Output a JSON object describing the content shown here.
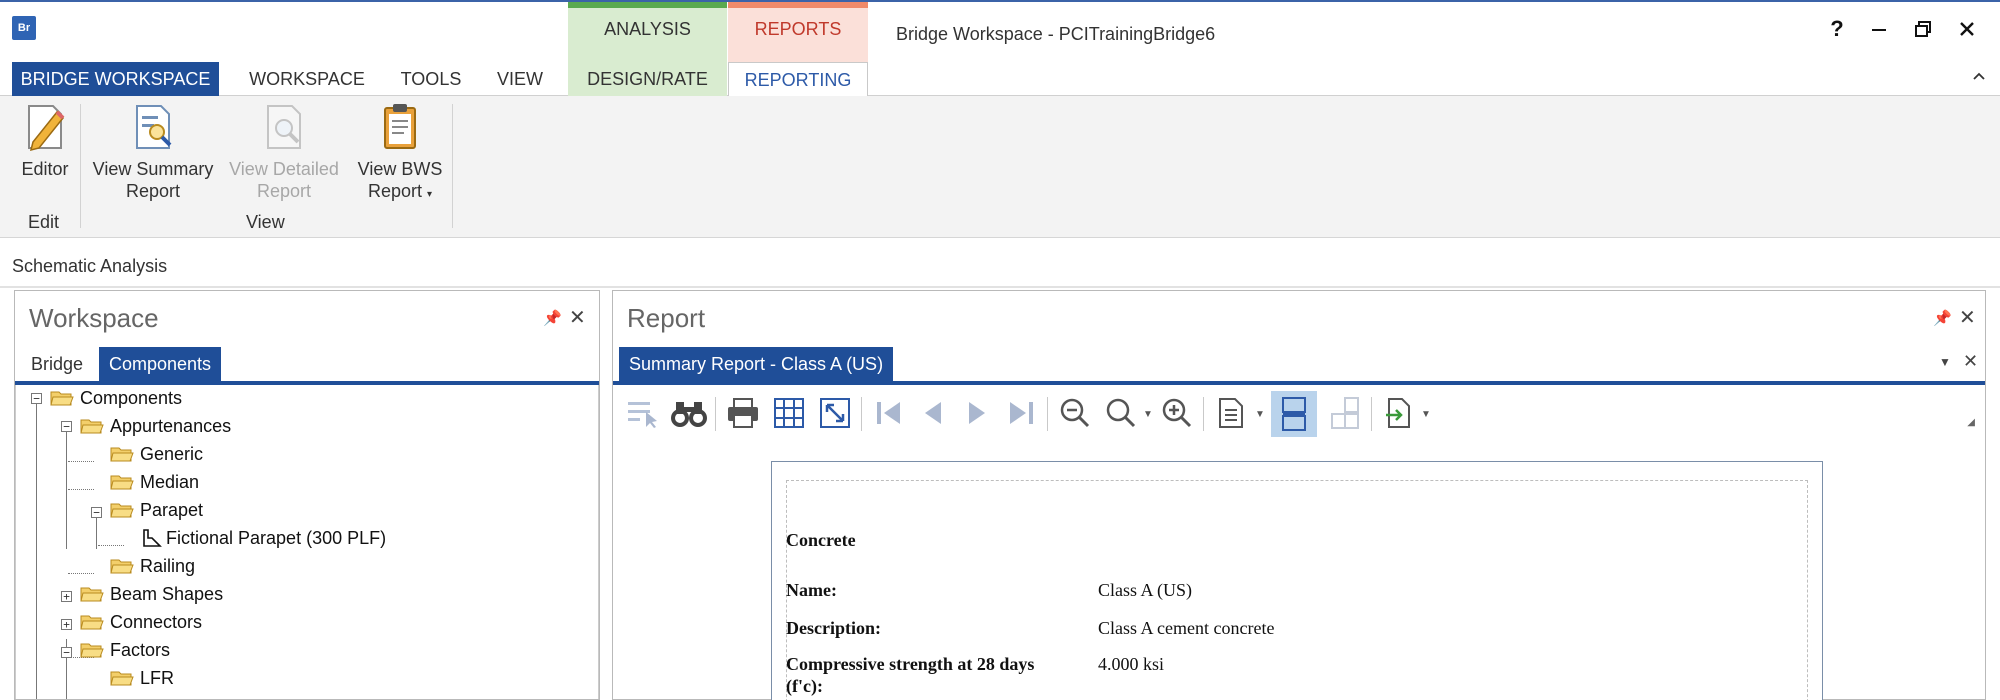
{
  "app": {
    "logo_text": "Br",
    "window_title": "Bridge Workspace - PCITrainingBridge6",
    "window_buttons": {
      "help": "?",
      "minimize": "—",
      "restore": "🗗",
      "close": "✕"
    }
  },
  "context_tabs": {
    "analysis": {
      "label": "ANALYSIS",
      "color": "#d9ecd0",
      "accent": "#5aaa4f"
    },
    "reports": {
      "label": "REPORTS",
      "color": "#fbe0d9",
      "accent": "#f08a6a"
    }
  },
  "tabs": [
    {
      "label": "BRIDGE WORKSPACE"
    },
    {
      "label": "WORKSPACE"
    },
    {
      "label": "TOOLS"
    },
    {
      "label": "VIEW"
    },
    {
      "label": "DESIGN/RATE"
    },
    {
      "label": "REPORTING"
    }
  ],
  "ribbon": {
    "editor": {
      "line1": "Editor",
      "line2": ""
    },
    "view_summary": {
      "line1": "View Summary",
      "line2": "Report"
    },
    "view_detailed": {
      "line1": "View Detailed",
      "line2": "Report"
    },
    "view_bws": {
      "line1": "View BWS",
      "line2": "Report"
    },
    "groups": {
      "edit": "Edit",
      "view": "View"
    }
  },
  "schematic_label": "Schematic  Analysis",
  "workspace_panel": {
    "title": "Workspace",
    "tabs": [
      "Bridge",
      "Components"
    ]
  },
  "tree": [
    {
      "label": "Components"
    },
    {
      "label": "Appurtenances"
    },
    {
      "label": "Generic"
    },
    {
      "label": "Median"
    },
    {
      "label": "Parapet"
    },
    {
      "label": "Fictional Parapet (300 PLF)"
    },
    {
      "label": "Railing"
    },
    {
      "label": "Beam Shapes"
    },
    {
      "label": "Connectors"
    },
    {
      "label": "Factors"
    },
    {
      "label": "LFR"
    }
  ],
  "report_panel": {
    "title": "Report",
    "doc_tab": "Summary Report - Class A (US)"
  },
  "report": {
    "section": "Concrete",
    "rows": [
      {
        "label": "Name:",
        "value": "Class A (US)"
      },
      {
        "label": "Description:",
        "value": "Class A cement concrete"
      },
      {
        "label": "Compressive strength at 28 days",
        "label2": "(f'c):",
        "value": "4.000 ksi"
      }
    ]
  }
}
